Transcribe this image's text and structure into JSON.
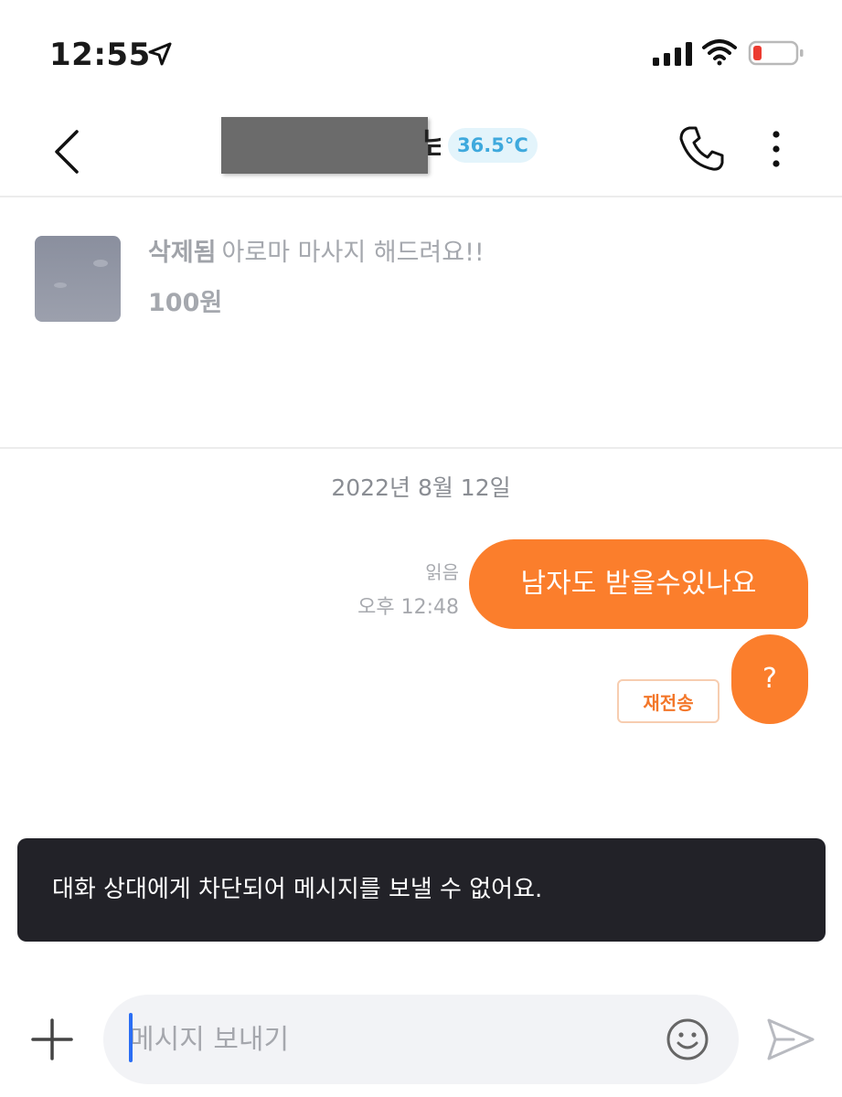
{
  "status_bar": {
    "time": "12:55",
    "icons": [
      "location-arrow-icon",
      "signal-icon",
      "wifi-icon",
      "battery-low-icon"
    ]
  },
  "header": {
    "name_tail": "님",
    "temperature": "36.5°C",
    "icons": [
      "chevron-left-icon",
      "phone-icon",
      "more-vertical-icon"
    ]
  },
  "product": {
    "status": "삭제됨",
    "title": "아로마 마사지 해드려요!!",
    "price": "100원"
  },
  "chat": {
    "date": "2022년 8월 12일",
    "messages": [
      {
        "text": "남자도 받을수있나요",
        "read": "읽음",
        "time": "오후 12:48"
      },
      {
        "text": "?",
        "resend_label": "재전송"
      }
    ]
  },
  "toast": {
    "text": "대화 상대에게 차단되어 메시지를 보낼 수 없어요."
  },
  "composer": {
    "placeholder": "메시지 보내기",
    "icons": [
      "plus-icon",
      "smile-icon",
      "send-icon"
    ]
  },
  "colors": {
    "accent": "#fb7e2c",
    "temperature": "#3ea9dd",
    "toast_bg": "#222228",
    "caret": "#2b6ef4"
  }
}
